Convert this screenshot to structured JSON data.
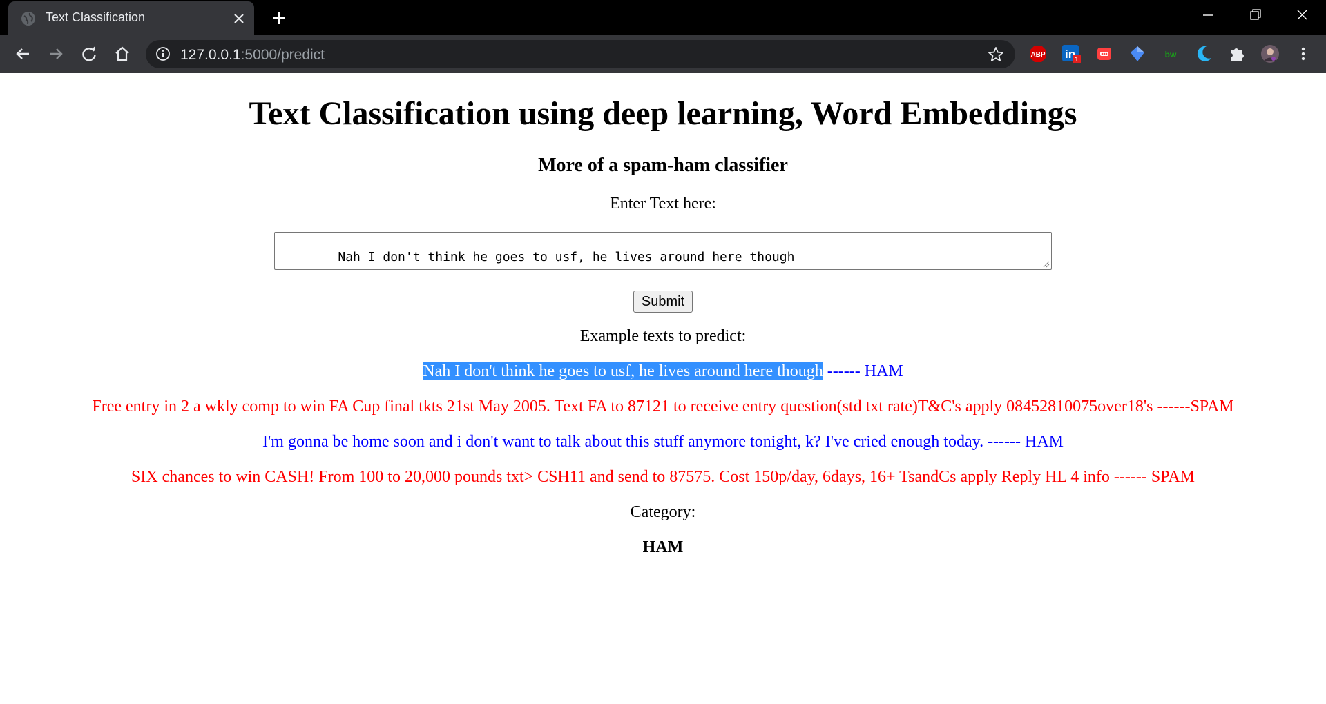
{
  "browser": {
    "tab_title": "Text Classification",
    "url_host": "127.0.0.1",
    "url_path": ":5000/predict",
    "extensions": [
      "abp-icon",
      "linkedin-icon",
      "red-extension-icon",
      "blue-extension-icon",
      "bw-icon",
      "moon-icon",
      "puzzle-icon",
      "profile-avatar"
    ],
    "abp_label": "ABP",
    "linkedin_badge": "1",
    "bw_label": "bw"
  },
  "page": {
    "title": "Text Classification using deep learning, Word Embeddings",
    "subtitle": "More of a spam-ham classifier",
    "input_label": "Enter Text here:",
    "input_value": "Nah I don't think he goes to usf, he lives around here though",
    "submit_label": "Submit",
    "examples_label": "Example texts to predict:",
    "examples": [
      {
        "text": "Nah I don't think he goes to usf, he lives around here though",
        "suffix": " ------ HAM",
        "color": "#0000ff"
      },
      {
        "text": "Free entry in 2 a wkly comp to win FA Cup final tkts 21st May 2005. Text FA to 87121 to receive entry question(std txt rate)T&C's apply 08452810075over18's ------SPAM",
        "color": "#ff0000"
      },
      {
        "text": "I'm gonna be home soon and i don't want to talk about this stuff anymore tonight, k? I've cried enough today. ------ HAM",
        "color": "#0000ff"
      },
      {
        "text": "SIX chances to win CASH! From 100 to 20,000 pounds txt> CSH11 and send to 87575. Cost 150p/day, 6days, 16+ TsandCs apply Reply HL 4 info ------ SPAM",
        "color": "#ff0000"
      }
    ],
    "category_label": "Category:",
    "category_value": "HAM"
  }
}
